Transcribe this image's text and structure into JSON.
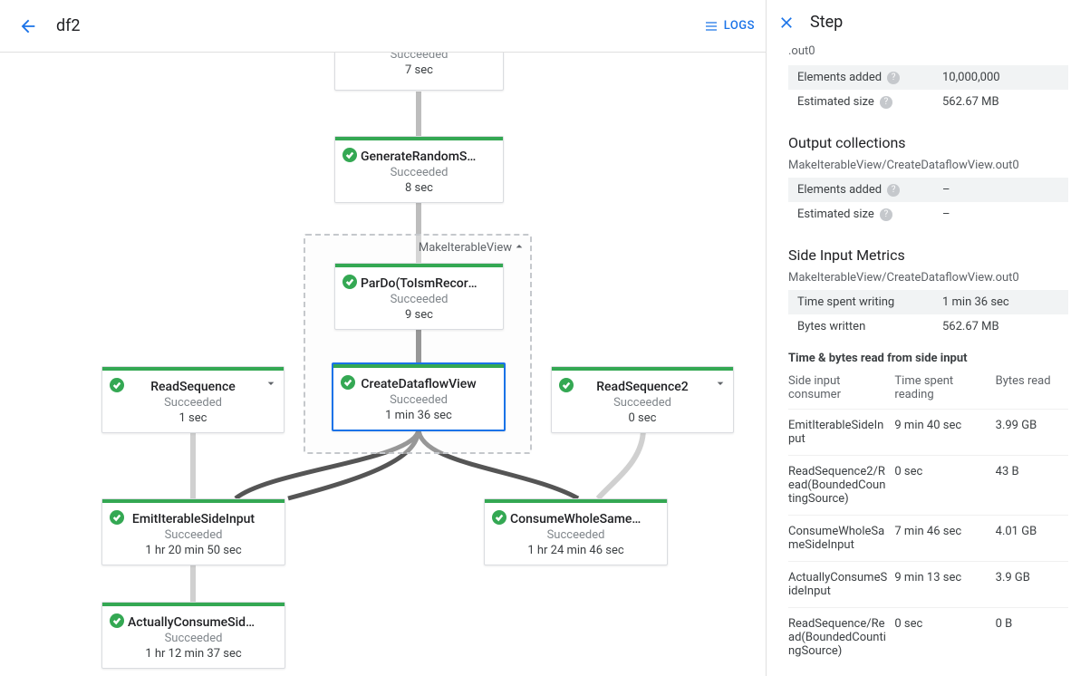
{
  "header": {
    "title": "df2",
    "logs_label": "LOGS"
  },
  "panel": {
    "title": "Step",
    "truncated_label": ".out0",
    "input_metrics": {
      "elements_added_label": "Elements added",
      "elements_added_value": "10,000,000",
      "estimated_size_label": "Estimated size",
      "estimated_size_value": "562.67 MB"
    },
    "output_collections": {
      "heading": "Output collections",
      "name": "MakeIterableView/CreateDataflowView.out0",
      "elements_added_label": "Elements added",
      "elements_added_value": "–",
      "estimated_size_label": "Estimated size",
      "estimated_size_value": "–"
    },
    "side_input": {
      "heading": "Side Input Metrics",
      "name": "MakeIterableView/CreateDataflowView.out0",
      "time_spent_label": "Time spent writing",
      "time_spent_value": "1 min 36 sec",
      "bytes_written_label": "Bytes written",
      "bytes_written_value": "562.67 MB",
      "table_heading": "Time & bytes read from side input",
      "columns": {
        "consumer": "Side input consumer",
        "time": "Time spent reading",
        "bytes": "Bytes read"
      },
      "rows": [
        {
          "consumer": "EmitIterableSideInput",
          "time": "9 min 40 sec",
          "bytes": "3.99 GB"
        },
        {
          "consumer": "ReadSequence2/Read(BoundedCountingSource)",
          "time": "0 sec",
          "bytes": "43 B"
        },
        {
          "consumer": "ConsumeWholeSameSideInput",
          "time": "7 min 46 sec",
          "bytes": "4.01 GB"
        },
        {
          "consumer": "ActuallyConsumeSideInput",
          "time": "9 min 13 sec",
          "bytes": "3.9 GB"
        },
        {
          "consumer": "ReadSequence/Read(BoundedCountingSource)",
          "time": "0 sec",
          "bytes": "0 B"
        }
      ]
    }
  },
  "graph": {
    "composite_label": "MakeIterableView",
    "nodes": {
      "n0": {
        "name": "",
        "status": "Succeeded",
        "time": "7 sec"
      },
      "n1": {
        "name": "GenerateRandomSIData",
        "status": "Succeeded",
        "time": "8 sec"
      },
      "n2": {
        "name": "ParDo(ToIsmRecordFor…",
        "status": "Succeeded",
        "time": "9 sec"
      },
      "n3": {
        "name": "CreateDataflowView",
        "status": "Succeeded",
        "time": "1 min 36 sec"
      },
      "n4": {
        "name": "ReadSequence",
        "status": "Succeeded",
        "time": "1 sec"
      },
      "n5": {
        "name": "ReadSequence2",
        "status": "Succeeded",
        "time": "0 sec"
      },
      "n6": {
        "name": "EmitIterableSideInput",
        "status": "Succeeded",
        "time": "1 hr 20 min 50 sec"
      },
      "n7": {
        "name": "ConsumeWholeSameSi…",
        "status": "Succeeded",
        "time": "1 hr 24 min 46 sec"
      },
      "n8": {
        "name": "ActuallyConsumeSideI…",
        "status": "Succeeded",
        "time": "1 hr 12 min 37 sec"
      }
    }
  }
}
